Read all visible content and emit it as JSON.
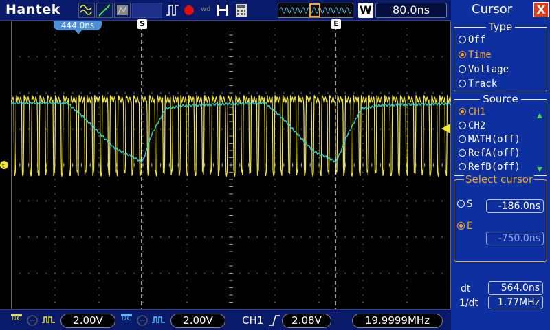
{
  "top": {
    "brand": "Hantek",
    "timebase": "80.0ns",
    "window_badge": "W"
  },
  "screen": {
    "trigger_position_label": "444.0ns",
    "cursor_s_label": "S",
    "cursor_e_label": "E"
  },
  "panel": {
    "title": "Cursor",
    "close": "X",
    "type_group": {
      "legend": "Type",
      "options": [
        "Off",
        "Time",
        "Voltage",
        "Track"
      ],
      "selected": "Time"
    },
    "source_group": {
      "legend": "Source",
      "options": [
        "CH1",
        "CH2",
        "MATH(off)",
        "RefA(off)",
        "RefB(off)"
      ],
      "selected": "CH1"
    },
    "select_cursor": {
      "legend": "Select cursor",
      "s_label": "S",
      "s_value": "-186.0ns",
      "e_label": "E",
      "e_value": "-750.0ns",
      "selected": "E"
    },
    "measure": {
      "dt_label": "dt",
      "dt_value": "564.0ns",
      "inv_dt_label": "1/dt",
      "inv_dt_value": "1.77MHz"
    }
  },
  "bottom": {
    "ch1_coupling": "DC",
    "ch1_volts": "2.00V",
    "ch2_coupling": "DC",
    "ch2_volts": "2.00V",
    "trigger_source": "CH1",
    "trigger_level": "2.08V",
    "frequency": "19.9999MHz"
  },
  "colors": {
    "ch1": "#f2e62c",
    "ch2": "#2fd3d3",
    "accent": "#f5a623",
    "panel_bg": "#0d2fa0",
    "bar_bg": "#0a1a6a"
  }
}
